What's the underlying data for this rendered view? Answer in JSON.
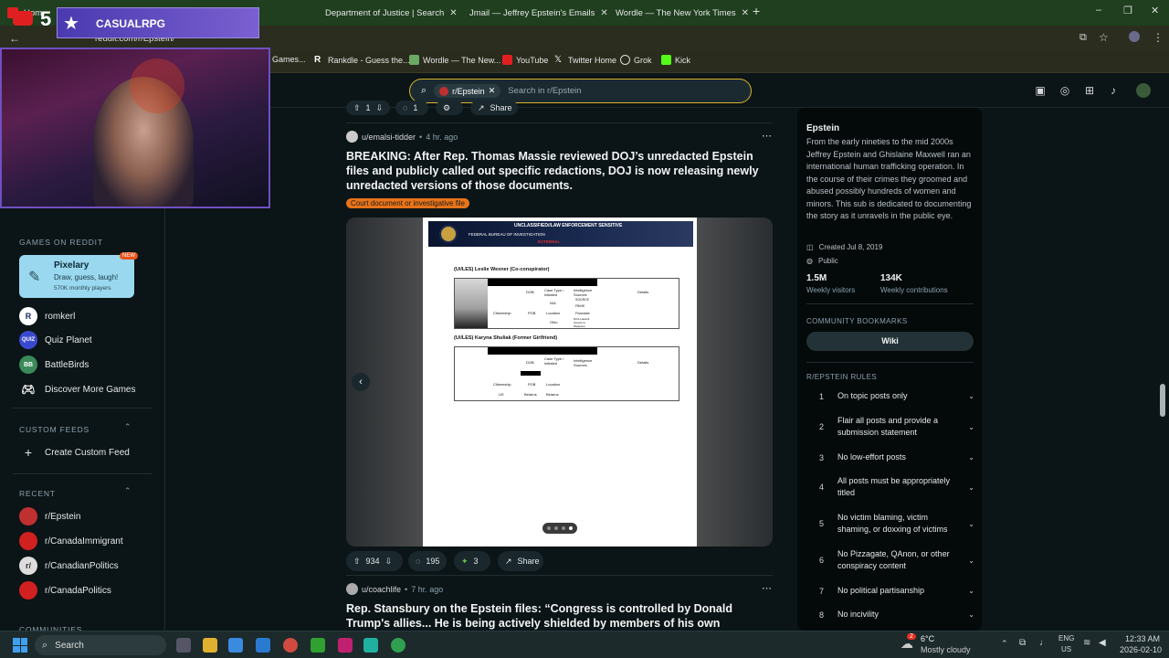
{
  "browser": {
    "tabs": [
      {
        "label": "Hom",
        "icon": "youtube-icon"
      },
      {
        "label": "Department of Justice | Search",
        "icon": "doj-icon"
      },
      {
        "label": "Jmail — Jeffrey Epstein's Emails",
        "icon": "mail-icon"
      },
      {
        "label": "Wordle — The New York Times",
        "icon": "wordle-icon"
      }
    ],
    "url": "reddit.com/r/Epstein/",
    "bookmarks": [
      "Games...",
      "Rankdle - Guess the...",
      "Wordle — The New...",
      "YouTube",
      "Twitter Home",
      "Grok",
      "Kick"
    ]
  },
  "stream": {
    "channel": "CASUALRPG",
    "badge": "5"
  },
  "header": {
    "subreddit_chip": "r/Epstein",
    "search_placeholder": "Search in r/Epstein"
  },
  "leftnav": {
    "games_heading": "GAMES ON REDDIT",
    "featured_game": {
      "name": "Pixelary",
      "desc": "Draw, guess, laugh!",
      "players": "570K monthly players",
      "badge": "NEW"
    },
    "games": [
      {
        "label": "romkerl",
        "icon": "R"
      },
      {
        "label": "Quiz Planet",
        "icon": "QUIZ"
      },
      {
        "label": "BattleBirds",
        "icon": "BB"
      },
      {
        "label": "Discover More Games",
        "icon": "gamepad"
      }
    ],
    "feeds_heading": "CUSTOM FEEDS",
    "create_feed": "Create Custom Feed",
    "recent_heading": "RECENT",
    "recent": [
      "r/Epstein",
      "r/CanadaImmigrant",
      "r/CanadianPolitics",
      "r/CanadaPolitics"
    ],
    "communities_heading": "COMMUNITIES"
  },
  "prev_post_actions": {
    "votes": "1",
    "comments": "1",
    "share": "Share"
  },
  "post": {
    "author": "u/emalsi-tidder",
    "age": "4 hr. ago",
    "title": "BREAKING: After Rep. Thomas Massie reviewed DOJ’s unredacted Epstein files and publicly called out specific redactions, DOJ is now releasing newly unredacted versions of those documents.",
    "flair": "Court document or investigative file",
    "votes": "934",
    "comments": "195",
    "awards": "3",
    "share": "Share",
    "carousel": {
      "index": 4,
      "total": 4
    }
  },
  "document": {
    "banner": "UNCLASSIFIED//LAW ENFORCEMENT SENSITIVE",
    "agency": "FEDERAL BUREAU OF INVESTIGATION",
    "tag": "EXTERNAL",
    "section1": "(U//LES) Leslie Wexner (Co-conspirator)",
    "section2": "(U//LES) Karyna Shuliak (Former Girlfriend)",
    "col_dob": "DOB",
    "col_case": "Case Type / Initiated",
    "col_intel": "Intelligence Sources",
    "col_details": "Details",
    "col_citizenship": "Citizenship",
    "col_pob": "POB",
    "col_location": "Location",
    "na": "N/A",
    "ohio": "Ohio",
    "us": "US",
    "belarus": "Belarus",
    "intel_1": "SOURCE",
    "intel_2": "FBIHE",
    "intel_3": "Financials",
    "intel_4": "DOA Lawsuit Access to Weapons"
  },
  "next_post": {
    "author": "u/coachlife",
    "age": "7 hr. ago",
    "title": "Rep. Stansbury on the Epstein files: “Congress is controlled by Donald Trump's allies... He is being actively shielded by members of his own party...We need to hold these"
  },
  "sidebar": {
    "name": "Epstein",
    "description": "From the early nineties to the mid 2000s Jeffrey Epstein and Ghislaine Maxwell ran an international human trafficking operation. In the course of their crimes they groomed and abused possibly hundreds of women and minors. This sub is dedicated to documenting the story as it unravels in the public eye.",
    "created": "Created Jul 8, 2019",
    "visibility": "Public",
    "visitors": "1.5M",
    "visitors_label": "Weekly visitors",
    "contribs": "134K",
    "contribs_label": "Weekly contributions",
    "bookmarks_heading": "COMMUNITY BOOKMARKS",
    "wiki": "Wiki",
    "rules_heading": "R/EPSTEIN RULES",
    "rules": [
      "On topic posts only",
      "Flair all posts and provide a submission statement",
      "No low-effort posts",
      "All posts must be appropriately titled",
      "No victim blaming, victim shaming, or doxxing of victims",
      "No Pizzagate, QAnon, or other conspiracy content",
      "No political partisanship",
      "No incivility"
    ]
  },
  "taskbar": {
    "search": "Search",
    "weather_temp": "6°C",
    "weather_desc": "Mostly cloudy",
    "lang1": "ENG",
    "lang2": "US",
    "time": "12:33 AM",
    "date": "2026-02-10",
    "notif_count": "2"
  },
  "colors": {
    "accent": "#d9b32a",
    "flair": "#e8741a",
    "pixelary": "#9ad8ef"
  }
}
